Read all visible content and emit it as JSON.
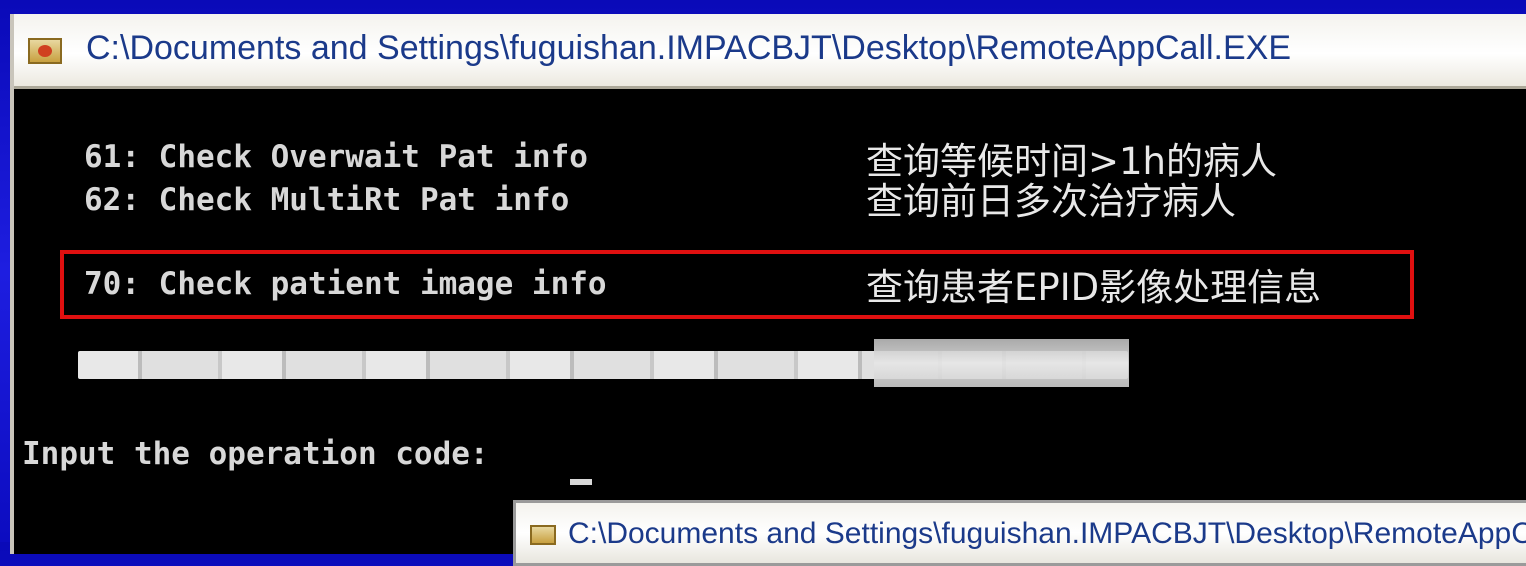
{
  "window": {
    "title": "C:\\Documents and Settings\\fuguishan.IMPACBJT\\Desktop\\RemoteAppCall.EXE"
  },
  "console": {
    "items": [
      {
        "code_line": "61: Check Overwait Pat info",
        "description": "查询等候时间>1h的病人"
      },
      {
        "code_line": "62: Check MultiRt Pat info",
        "description": "查询前日多次治疗病人"
      },
      {
        "code_line": "70: Check patient image info",
        "description": "查询患者EPID影像处理信息"
      }
    ],
    "prompt": "Input the operation code: "
  },
  "second_window": {
    "title": "C:\\Documents and Settings\\fuguishan.IMPACBJT\\Desktop\\RemoteAppCa"
  },
  "colors": {
    "desktop_blue": "#1a1ad0",
    "highlight_border": "#e01010",
    "console_bg": "#000000",
    "console_text": "#d8d8d8"
  }
}
